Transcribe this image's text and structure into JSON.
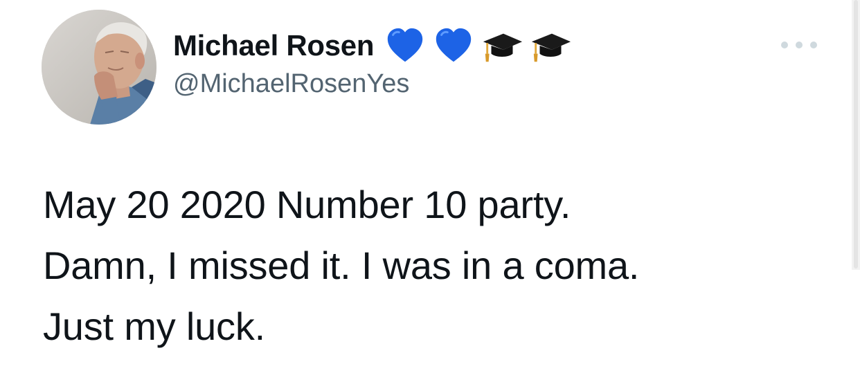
{
  "author": {
    "display_name": "Michael Rosen",
    "handle": "@MichaelRosenYes",
    "name_emojis": [
      "blue-heart-icon",
      "blue-heart-icon",
      "graduation-cap-icon",
      "graduation-cap-icon"
    ]
  },
  "tweet": {
    "lines": [
      "May 20 2020 Number 10 party.",
      "Damn, I missed it. I was in a coma.",
      "Just my luck."
    ]
  },
  "colors": {
    "text": "#0f1419",
    "handle": "#536471",
    "heart": "#1d63e6",
    "more_dots": "#cfd9de"
  }
}
